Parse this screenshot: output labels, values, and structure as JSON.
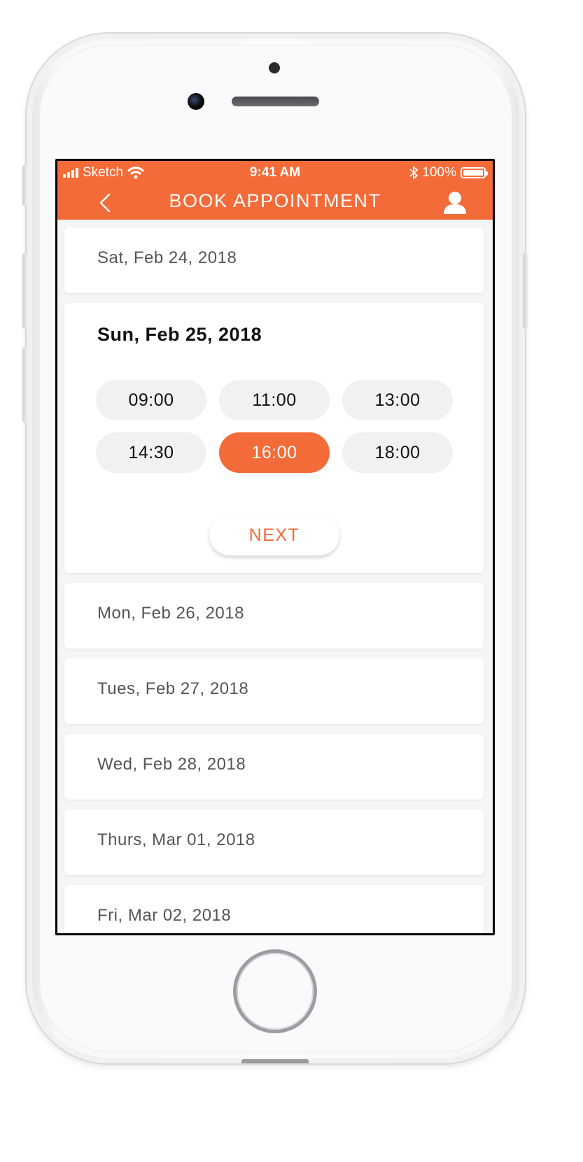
{
  "status_bar": {
    "carrier": "Sketch",
    "time": "9:41 AM",
    "battery": "100%"
  },
  "header": {
    "title": "BOOK APPOINTMENT",
    "back_icon": "chevron-left-icon",
    "profile_icon": "user-icon"
  },
  "colors": {
    "accent": "#f36b38",
    "slot_bg": "#f1f1f2",
    "background": "#f5f5f6"
  },
  "days": [
    {
      "label": "Sat, Feb 24, 2018"
    },
    {
      "label": "Sun, Feb 25, 2018",
      "expanded": true,
      "slots": [
        "09:00",
        "11:00",
        "13:00",
        "14:30",
        "16:00",
        "18:00"
      ],
      "selected_slot": "16:00",
      "next_label": "NEXT"
    },
    {
      "label": "Mon, Feb 26, 2018"
    },
    {
      "label": "Tues, Feb 27, 2018"
    },
    {
      "label": "Wed, Feb 28, 2018"
    },
    {
      "label": "Thurs, Mar 01, 2018"
    },
    {
      "label": "Fri, Mar 02, 2018"
    }
  ]
}
